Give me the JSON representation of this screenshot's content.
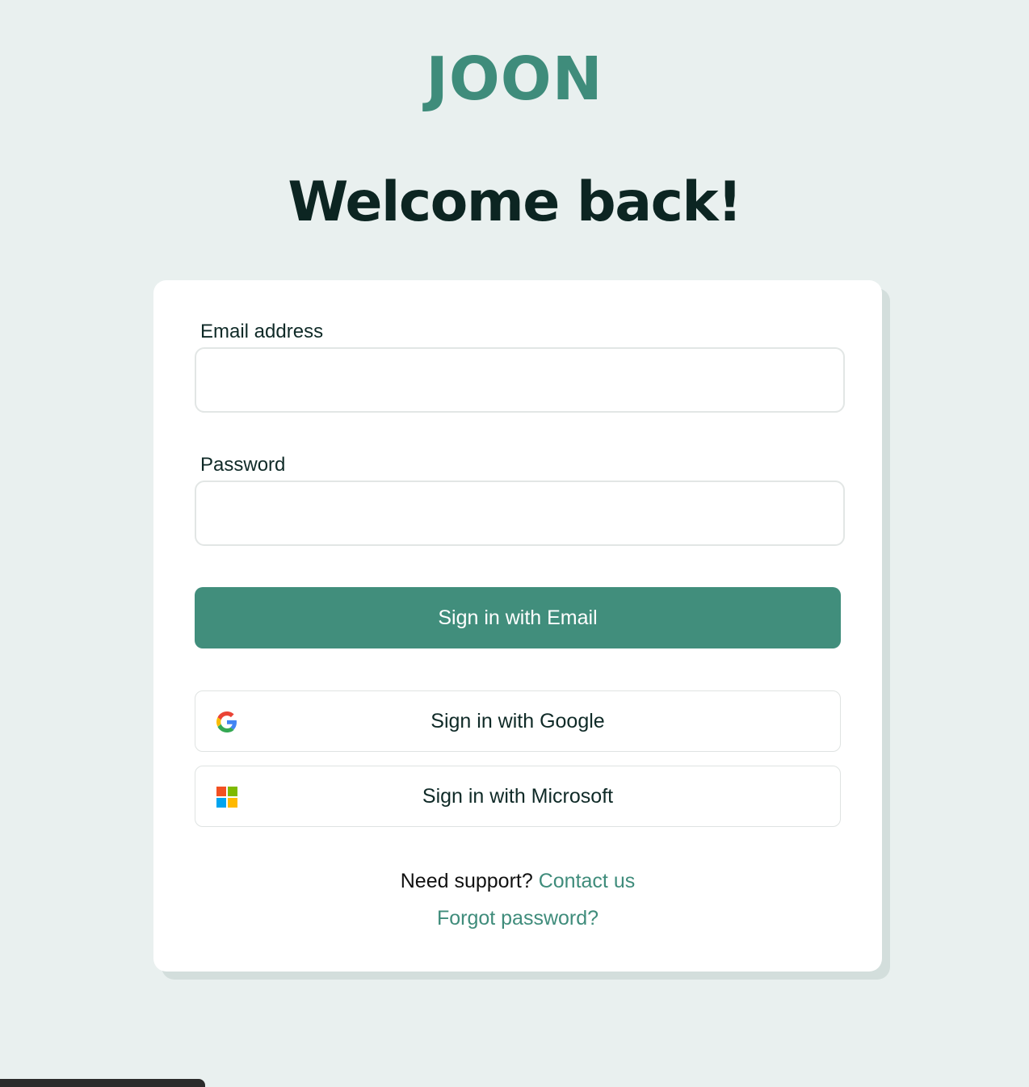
{
  "brand": {
    "logo_text": "JOON",
    "accent_color": "#418e7c"
  },
  "header": {
    "title": "Welcome back!"
  },
  "form": {
    "email_label": "Email address",
    "email_value": "",
    "password_label": "Password",
    "password_value": "",
    "email_button_label": "Sign in with Email",
    "google_button_label": "Sign in with Google",
    "google_icon": "google-g-icon",
    "microsoft_button_label": "Sign in with Microsoft",
    "microsoft_icon": "microsoft-windows-icon"
  },
  "footer": {
    "support_text": "Need support?",
    "contact_link": "Contact us",
    "forgot_link": "Forgot password?"
  }
}
